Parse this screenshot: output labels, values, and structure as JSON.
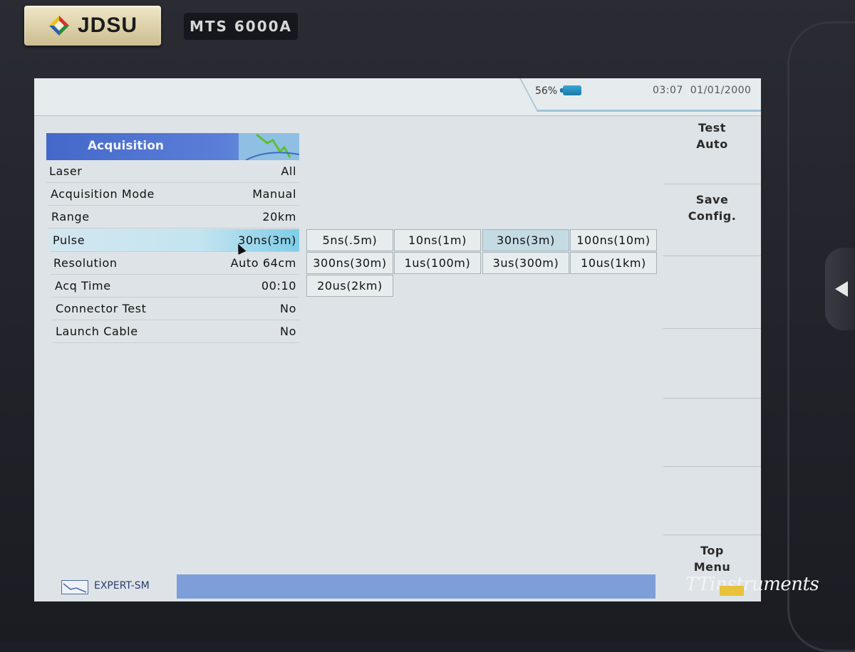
{
  "device": {
    "brand": "JDSU",
    "model": "MTS 6000A"
  },
  "status": {
    "battery": "56%",
    "time": "03:07",
    "date": "01/01/2000"
  },
  "panel": {
    "title": "Acquisition",
    "rows": [
      {
        "label": "Laser",
        "value": "All"
      },
      {
        "label": "Acquisition Mode",
        "value": "Manual"
      },
      {
        "label": "Range",
        "value": "20km"
      },
      {
        "label": "Pulse",
        "value": "30ns(3m)",
        "selected": true
      },
      {
        "label": "Resolution",
        "value": "Auto 64cm"
      },
      {
        "label": "Acq Time",
        "value": "00:10"
      },
      {
        "label": "Connector Test",
        "value": "No"
      },
      {
        "label": "Launch Cable",
        "value": "No"
      }
    ]
  },
  "pulse_options": [
    "5ns(.5m)",
    "10ns(1m)",
    "30ns(3m)",
    "100ns(10m)",
    "300ns(30m)",
    "1us(100m)",
    "3us(300m)",
    "10us(1km)",
    "20us(2km)"
  ],
  "pulse_selected": "30ns(3m)",
  "softkeys": {
    "test_auto": [
      "Test",
      "Auto"
    ],
    "save_config": [
      "Save",
      "Config."
    ],
    "top_menu": [
      "Top",
      "Menu"
    ]
  },
  "footer": {
    "mode": "EXPERT-SM"
  },
  "watermark": "TTinstruments",
  "colors": {
    "header_blue": "#4468c9",
    "status_fill": "#7e9ed9",
    "selected_row": "#7fcde8"
  }
}
